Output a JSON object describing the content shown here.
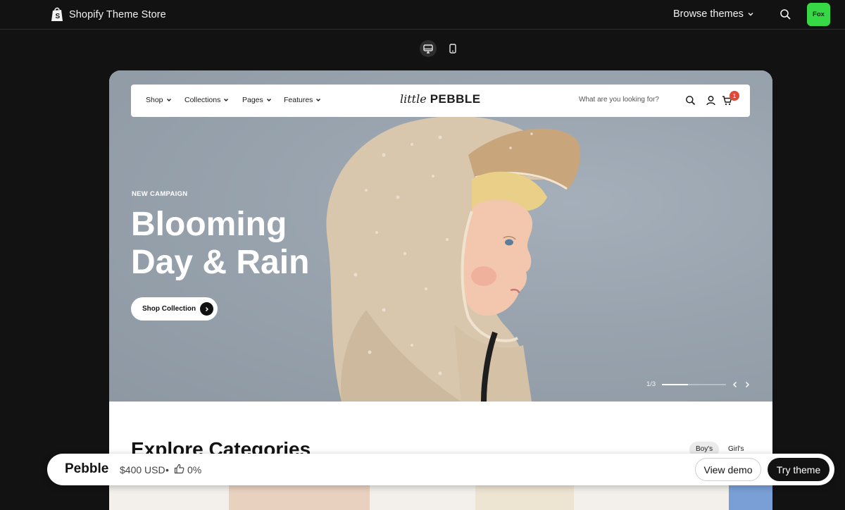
{
  "topbar": {
    "brand": "Shopify Theme Store",
    "browse_label": "Browse themes",
    "avatar_text": "Fox",
    "avatar_color": "#36d845"
  },
  "device_toggle": {
    "options": [
      "desktop-icon",
      "mobile-icon"
    ],
    "selected": "desktop"
  },
  "store": {
    "nav": [
      "Shop",
      "Collections",
      "Pages",
      "Features"
    ],
    "logo_script": "little",
    "logo_bold": "PEBBLE",
    "search_placeholder": "What are you looking for?",
    "cart_count": "1"
  },
  "hero": {
    "eyebrow": "NEW CAMPAIGN",
    "headline_line1": "Blooming",
    "headline_line2": "Day & Rain",
    "cta": "Shop Collection",
    "slide_counter": "1/3",
    "slide_progress": 0.41
  },
  "categories": {
    "title": "Explore Categories",
    "tabs": [
      "Boy's",
      "Girl's"
    ],
    "active_tab": "Boy's"
  },
  "bottombar": {
    "theme_name": "Pebble",
    "price": "$400 USD",
    "separator": "•",
    "rating": "0%",
    "view_demo": "View demo",
    "try_theme": "Try theme"
  },
  "colors": {
    "page_bg": "#121212",
    "hero_bg": "#98a3ae",
    "cart_badge": "#e0483a"
  }
}
